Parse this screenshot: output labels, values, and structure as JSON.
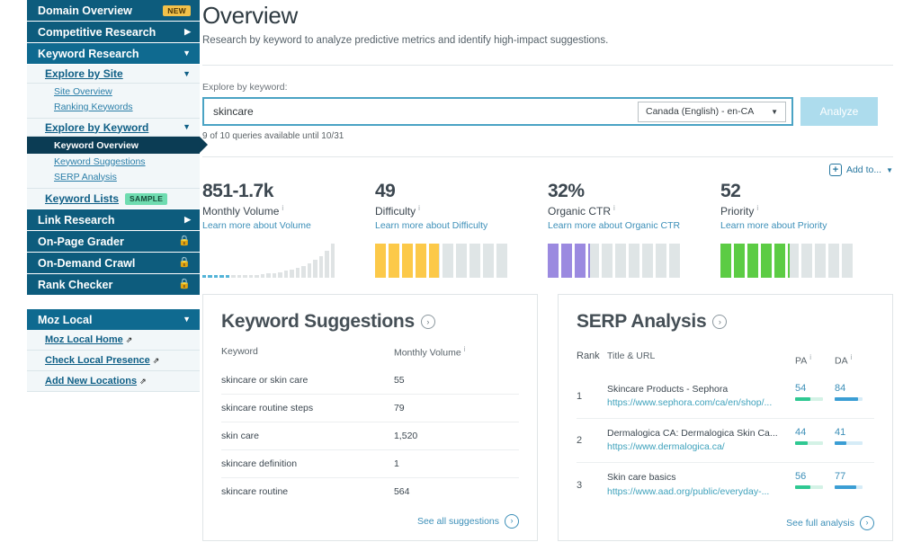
{
  "sidebar": {
    "top_items": [
      {
        "label": "Domain Overview",
        "badge": "NEW",
        "icon": "",
        "name": "domain-overview"
      },
      {
        "label": "Competitive Research",
        "badge": "",
        "icon": "▶",
        "name": "competitive-research"
      },
      {
        "label": "Keyword Research",
        "badge": "",
        "icon": "▼",
        "name": "keyword-research"
      }
    ],
    "explore_by_site": {
      "label": "Explore by Site",
      "caret": "▼"
    },
    "site_links": [
      {
        "label": "Site Overview"
      },
      {
        "label": "Ranking Keywords"
      }
    ],
    "explore_by_keyword": {
      "label": "Explore by Keyword",
      "caret": "▼"
    },
    "keyword_active": "Keyword Overview",
    "keyword_links": [
      {
        "label": "Keyword Suggestions"
      },
      {
        "label": "SERP Analysis"
      }
    ],
    "keyword_lists": {
      "label": "Keyword Lists",
      "badge": "SAMPLE"
    },
    "bottom_items": [
      {
        "label": "Link Research",
        "icon": "▶",
        "name": "link-research"
      },
      {
        "label": "On-Page Grader",
        "icon": "🔒",
        "name": "on-page-grader"
      },
      {
        "label": "On-Demand Crawl",
        "icon": "🔒",
        "name": "on-demand-crawl"
      },
      {
        "label": "Rank Checker",
        "icon": "🔒",
        "name": "rank-checker"
      }
    ],
    "moz_local": {
      "title": "Moz Local",
      "caret": "▼",
      "links": [
        {
          "label": "Moz Local Home",
          "icon": "⇗"
        },
        {
          "label": "Check Local Presence",
          "icon": "⇗"
        },
        {
          "label": "Add New Locations",
          "icon": "⇗"
        }
      ]
    }
  },
  "header": {
    "title": "Overview",
    "subtitle": "Research by keyword to analyze predictive metrics and identify high-impact suggestions."
  },
  "search": {
    "label": "Explore by keyword:",
    "value": "skincare",
    "placeholder": "Enter a keyword",
    "language": "Canada (English) - en-CA",
    "language_arrow": "▼",
    "analyze_label": "Analyze",
    "quota": "9 of 10 queries available until 10/31"
  },
  "addto": {
    "label": "Add to...",
    "plus": "+",
    "arrow": "▼"
  },
  "metrics": [
    {
      "value": "851-1.7k",
      "name": "Monthly Volume",
      "learn": "Learn more about Volume",
      "type": "sparkline",
      "color": "#54b4d8",
      "filled": 0,
      "spark_heights": [
        4,
        4,
        4,
        5,
        5,
        6,
        6,
        7,
        8,
        9,
        10,
        12,
        14,
        17,
        20,
        24,
        29,
        35,
        43,
        52,
        63,
        78,
        100
      ],
      "spark_blue_count": 5
    },
    {
      "value": "49",
      "name": "Difficulty",
      "learn": "Learn more about Difficulty",
      "type": "segments",
      "color": "#fcc949",
      "filled": 4.9
    },
    {
      "value": "32%",
      "name": "Organic CTR",
      "learn": "Learn more about Organic CTR",
      "type": "segments",
      "color": "#9b8ae0",
      "filled": 3.2
    },
    {
      "value": "52",
      "name": "Priority",
      "learn": "Learn more about Priority",
      "type": "segments",
      "color": "#5ccc44",
      "filled": 5.2
    }
  ],
  "suggestions": {
    "title": "Keyword Suggestions",
    "columns": [
      "Keyword",
      "Monthly Volume"
    ],
    "rows": [
      {
        "keyword": "skincare or skin care",
        "volume": "55"
      },
      {
        "keyword": "skincare routine steps",
        "volume": "79"
      },
      {
        "keyword": "skin care",
        "volume": "1,520"
      },
      {
        "keyword": "skincare definition",
        "volume": "1"
      },
      {
        "keyword": "skincare routine",
        "volume": "564"
      }
    ],
    "footer_link": "See all suggestions"
  },
  "serp": {
    "title": "SERP Analysis",
    "columns": [
      "Rank",
      "Title & URL",
      "PA",
      "DA"
    ],
    "rows": [
      {
        "rank": "1",
        "title": "Skincare Products - Sephora",
        "url": "https://www.sephora.com/ca/en/shop/...",
        "pa": "54",
        "da": "84"
      },
      {
        "rank": "2",
        "title": "Dermalogica CA: Dermalogica Skin Ca...",
        "url": "https://www.dermalogica.ca/",
        "pa": "44",
        "da": "41"
      },
      {
        "rank": "3",
        "title": "Skin care basics",
        "url": "https://www.aad.org/public/everyday-...",
        "pa": "56",
        "da": "77"
      }
    ],
    "footer_link": "See full analysis"
  },
  "colors": {
    "nav_dark": "#0d5c7d",
    "nav_mid": "#0f6a90",
    "nav_active": "#0b3c54",
    "link_blue": "#2a7ea8",
    "accent": "#3c8fb8"
  }
}
